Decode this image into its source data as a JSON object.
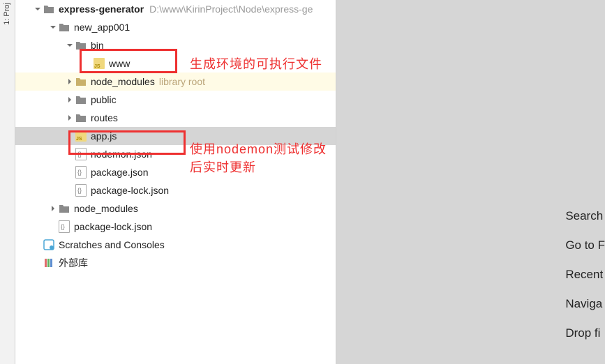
{
  "left_tab": "1: Proj",
  "tree": {
    "root": {
      "name": "express-generator",
      "path": "D:\\www\\KirinProject\\Node\\express-ge"
    },
    "new_app": "new_app001",
    "bin": "bin",
    "www": "www",
    "node_modules": "node_modules",
    "library_root": "library root",
    "public": "public",
    "routes": "routes",
    "app_js": "app.js",
    "nodemon_json": "nodemon.json",
    "package_json": "package.json",
    "package_lock": "package-lock.json",
    "outer_node_modules": "node_modules",
    "outer_package_lock": "package-lock.json",
    "scratches": "Scratches and Consoles",
    "external_lib": "外部库"
  },
  "annotations": {
    "www_note": "生成环境的可执行文件",
    "appjs_note": "使用nodemon测试修改后实时更新"
  },
  "tips": {
    "search": "Search",
    "go_to": "Go to F",
    "recent": "Recent",
    "navigate": "Naviga",
    "drop": "Drop fi"
  }
}
